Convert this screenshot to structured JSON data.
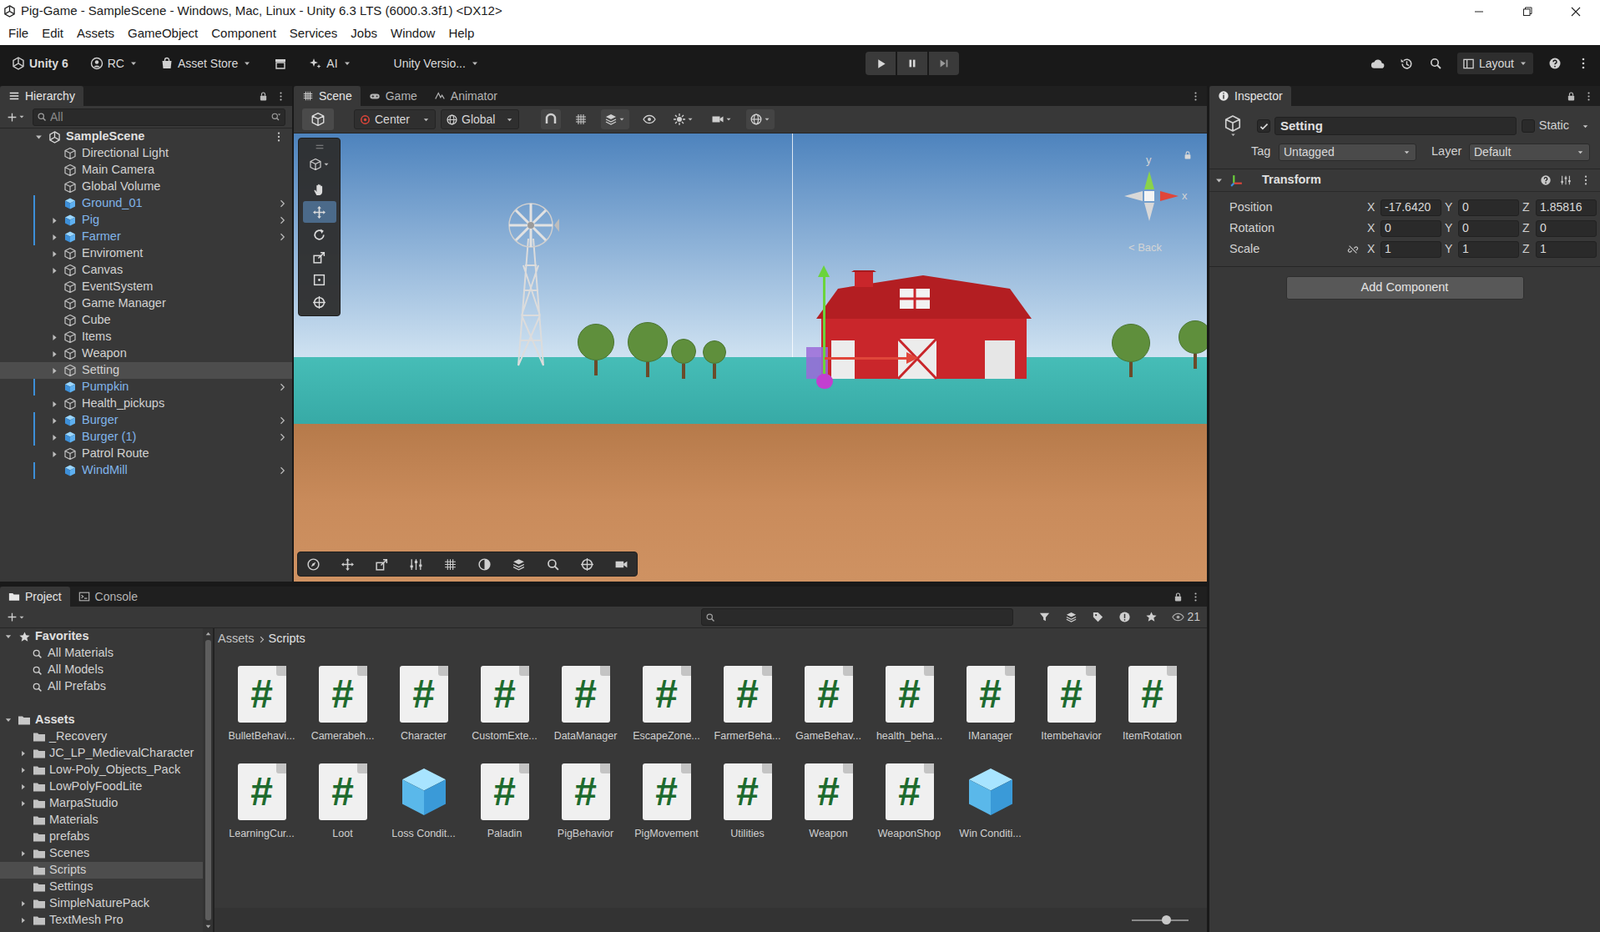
{
  "window": {
    "title": "Pig-Game - SampleScene - Windows, Mac, Linux - Unity 6.3 LTS (6000.3.3f1) <DX12>"
  },
  "menu": [
    "File",
    "Edit",
    "Assets",
    "GameObject",
    "Component",
    "Services",
    "Jobs",
    "Window",
    "Help"
  ],
  "toolbar": {
    "unity": "Unity 6",
    "account": "RC",
    "asset_store": "Asset Store",
    "ai": "AI",
    "version_control": "Unity Versio...",
    "layout": "Layout",
    "playing": false
  },
  "hierarchy": {
    "title": "Hierarchy",
    "search": {
      "placeholder": "All"
    },
    "scene": "SampleScene",
    "expanded": true,
    "items": [
      {
        "name": "Directional Light",
        "kind": "object",
        "expandable": false,
        "selected": false
      },
      {
        "name": "Main Camera",
        "kind": "object",
        "expandable": false,
        "selected": false
      },
      {
        "name": "Global Volume",
        "kind": "object",
        "expandable": false,
        "selected": false
      },
      {
        "name": "Ground_01",
        "kind": "prefab",
        "expandable": false,
        "selected": false
      },
      {
        "name": "Pig",
        "kind": "prefab",
        "expandable": true,
        "selected": false
      },
      {
        "name": "Farmer",
        "kind": "prefab",
        "expandable": true,
        "selected": false
      },
      {
        "name": "Enviroment",
        "kind": "object",
        "expandable": true,
        "selected": false
      },
      {
        "name": "Canvas",
        "kind": "object",
        "expandable": true,
        "selected": false
      },
      {
        "name": "EventSystem",
        "kind": "object",
        "expandable": false,
        "selected": false
      },
      {
        "name": "Game Manager",
        "kind": "object",
        "expandable": false,
        "selected": false
      },
      {
        "name": "Cube",
        "kind": "object",
        "expandable": false,
        "selected": false
      },
      {
        "name": "Items",
        "kind": "object",
        "expandable": true,
        "selected": false
      },
      {
        "name": "Weapon",
        "kind": "object",
        "expandable": true,
        "selected": false
      },
      {
        "name": "Setting",
        "kind": "object",
        "expandable": true,
        "selected": true
      },
      {
        "name": "Pumpkin",
        "kind": "prefab",
        "expandable": false,
        "selected": false
      },
      {
        "name": "Health_pickups",
        "kind": "object",
        "expandable": true,
        "selected": false
      },
      {
        "name": "Burger",
        "kind": "prefab",
        "expandable": true,
        "selected": false
      },
      {
        "name": "Burger (1)",
        "kind": "prefab",
        "expandable": true,
        "selected": false
      },
      {
        "name": "Patrol Route",
        "kind": "object",
        "expandable": true,
        "selected": false
      },
      {
        "name": "WindMill",
        "kind": "prefab",
        "expandable": false,
        "selected": false
      }
    ]
  },
  "scene_view": {
    "tabs": [
      {
        "label": "Scene",
        "selected": true
      },
      {
        "label": "Game",
        "selected": false
      },
      {
        "label": "Animator",
        "selected": false
      }
    ],
    "pivot": "Center",
    "space": "Global",
    "tools": [
      {
        "kind": "hand",
        "selected": false
      },
      {
        "kind": "move",
        "selected": true
      },
      {
        "kind": "rotate",
        "selected": false
      },
      {
        "kind": "scale",
        "selected": false
      },
      {
        "kind": "rect",
        "selected": false
      },
      {
        "kind": "transform",
        "selected": false
      }
    ],
    "gizmo": {
      "y": "y",
      "x": "x",
      "back": "< Back"
    }
  },
  "inspector": {
    "title": "Inspector",
    "object": {
      "name": "Setting",
      "active": true,
      "static": false,
      "static_label": "Static",
      "tag_label": "Tag",
      "tag": "Untagged",
      "layer_label": "Layer",
      "layer": "Default"
    },
    "component": {
      "name": "Transform",
      "expanded": true,
      "rows": [
        {
          "label": "Position",
          "values": [
            {
              "axis": "X",
              "value": "-17.6420"
            },
            {
              "axis": "Y",
              "value": "0"
            },
            {
              "axis": "Z",
              "value": "1.85816"
            }
          ]
        },
        {
          "label": "Rotation",
          "values": [
            {
              "axis": "X",
              "value": "0"
            },
            {
              "axis": "Y",
              "value": "0"
            },
            {
              "axis": "Z",
              "value": "0"
            }
          ]
        },
        {
          "label": "Scale",
          "constrained": false,
          "values": [
            {
              "axis": "X",
              "value": "1"
            },
            {
              "axis": "Y",
              "value": "1"
            },
            {
              "axis": "Z",
              "value": "1"
            }
          ]
        }
      ]
    },
    "add_component": "Add Component"
  },
  "project": {
    "tabs": [
      {
        "label": "Project",
        "selected": true
      },
      {
        "label": "Console",
        "selected": false
      }
    ],
    "count": "21",
    "favorites": {
      "label": "Favorites",
      "expanded": true,
      "items": [
        "All Materials",
        "All Models",
        "All Prefabs"
      ]
    },
    "assets": {
      "label": "Assets",
      "expanded": true,
      "folders": [
        {
          "name": "_Recovery",
          "expandable": false,
          "selected": false
        },
        {
          "name": "JC_LP_MedievalCharacter",
          "expandable": true,
          "selected": false
        },
        {
          "name": "Low-Poly_Objects_Pack",
          "expandable": true,
          "selected": false
        },
        {
          "name": "LowPolyFoodLite",
          "expandable": true,
          "selected": false
        },
        {
          "name": "MarpaStudio",
          "expandable": true,
          "selected": false
        },
        {
          "name": "Materials",
          "expandable": false,
          "selected": false
        },
        {
          "name": "prefabs",
          "expandable": false,
          "selected": false
        },
        {
          "name": "Scenes",
          "expandable": true,
          "selected": false
        },
        {
          "name": "Scripts",
          "expandable": false,
          "selected": true
        },
        {
          "name": "Settings",
          "expandable": false,
          "selected": false
        },
        {
          "name": "SimpleNaturePack",
          "expandable": true,
          "selected": false
        },
        {
          "name": "TextMesh Pro",
          "expandable": true,
          "selected": false
        }
      ]
    },
    "breadcrumb": [
      "Assets",
      "Scripts"
    ],
    "script_glyph": "#",
    "files": [
      {
        "name": "BulletBehavi...",
        "kind": "script"
      },
      {
        "name": "Camerabeh...",
        "kind": "script"
      },
      {
        "name": "Character",
        "kind": "script"
      },
      {
        "name": "CustomExte...",
        "kind": "script"
      },
      {
        "name": "DataManager",
        "kind": "script"
      },
      {
        "name": "EscapeZone...",
        "kind": "script"
      },
      {
        "name": "FarmerBeha...",
        "kind": "script"
      },
      {
        "name": "GameBehav...",
        "kind": "script"
      },
      {
        "name": "health_beha...",
        "kind": "script"
      },
      {
        "name": "IManager",
        "kind": "script"
      },
      {
        "name": "Itembehavior",
        "kind": "script"
      },
      {
        "name": "ItemRotation",
        "kind": "script"
      },
      {
        "name": "LearningCur...",
        "kind": "script"
      },
      {
        "name": "Loot",
        "kind": "script"
      },
      {
        "name": "Loss Condit...",
        "kind": "prefab"
      },
      {
        "name": "Paladin",
        "kind": "script"
      },
      {
        "name": "PigBehavior",
        "kind": "script"
      },
      {
        "name": "PigMovement",
        "kind": "script"
      },
      {
        "name": "Utilities",
        "kind": "script"
      },
      {
        "name": "Weapon",
        "kind": "script"
      },
      {
        "name": "WeaponShop",
        "kind": "script"
      },
      {
        "name": "Win Conditi...",
        "kind": "prefab"
      }
    ],
    "zoom_level": 0.6
  }
}
